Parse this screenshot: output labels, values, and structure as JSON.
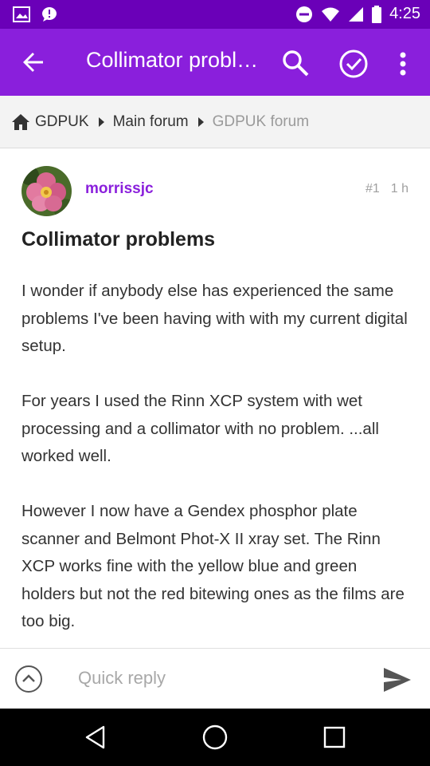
{
  "status_bar": {
    "time": "4:25",
    "icons": [
      "image-icon",
      "chat-icon",
      "do-not-disturb-icon",
      "wifi-icon",
      "signal-icon",
      "battery-icon"
    ]
  },
  "app_bar": {
    "title": "Collimator problems",
    "icons": [
      "back-arrow-icon",
      "search-icon",
      "check-circle-icon",
      "more-vert-icon"
    ],
    "background": "#8a1fdc",
    "status_background": "#6a00b8"
  },
  "breadcrumb": {
    "items": [
      "GDPUK",
      "Main forum",
      "GDPUK forum"
    ]
  },
  "post": {
    "author": "morrissjc",
    "number": "#1",
    "age": "1 h",
    "title": "Collimator problems",
    "paragraphs": [
      "I wonder if anybody else has experienced the same problems I've been having with with my current digital setup.",
      "For years I used the Rinn XCP system with wet processing and a collimator with no problem. ...all worked well.",
      "However I now have a Gendex phosphor plate scanner and Belmont Phot-X II xray set. The Rinn XCP works fine with the yellow blue and green holders but not the red bitewing ones as the films are too big."
    ]
  },
  "reply": {
    "placeholder": "Quick reply",
    "value": ""
  },
  "nav_bar": {
    "icons": [
      "back-triangle-icon",
      "home-circle-icon",
      "recents-square-icon"
    ]
  }
}
